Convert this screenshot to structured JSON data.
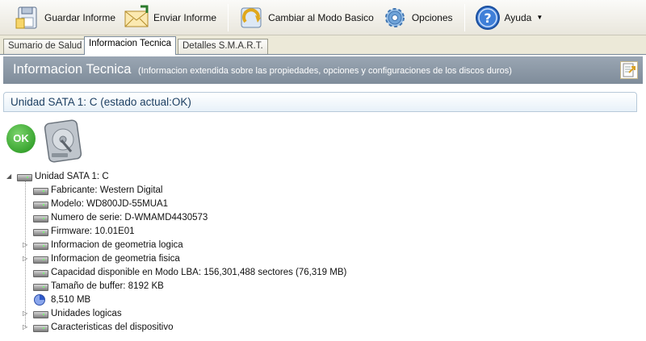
{
  "toolbar": {
    "save_report": "Guardar Informe",
    "send_report": "Enviar Informe",
    "basic_mode": "Cambiar al Modo Basico",
    "options": "Opciones",
    "help": "Ayuda"
  },
  "tabs": [
    {
      "label": "Sumario de Salud"
    },
    {
      "label": "Informacion Tecnica"
    },
    {
      "label": "Detalles S.M.A.R.T."
    }
  ],
  "header": {
    "title": "Informacion Tecnica",
    "subtitle": "(Informacion extendida sobre las propiedades, opciones y configuraciones de los discos duros)"
  },
  "section": {
    "title": "Unidad SATA 1: C (estado actual:OK)",
    "status_badge": "OK"
  },
  "tree": {
    "root": "Unidad SATA 1: C",
    "items": [
      {
        "label": "Fabricante: Western Digital",
        "icon": "drive-icon",
        "expandable": false
      },
      {
        "label": "Modelo: WD800JD-55MUA1",
        "icon": "drive-icon",
        "expandable": false
      },
      {
        "label": "Numero de serie: D-WMAMD4430573",
        "icon": "drive-icon",
        "expandable": false
      },
      {
        "label": "Firmware: 10.01E01",
        "icon": "drive-icon",
        "expandable": false
      },
      {
        "label": "Informacion de geometria logica",
        "icon": "drive-icon",
        "expandable": true
      },
      {
        "label": "Informacion de geometria fisica",
        "icon": "drive-icon",
        "expandable": true
      },
      {
        "label": "Capacidad disponible en Modo LBA: 156,301,488 sectores (76,319 MB)",
        "icon": "drive-icon",
        "expandable": false
      },
      {
        "label": "Tamaño de buffer: 8192 KB",
        "icon": "drive-icon",
        "expandable": false
      },
      {
        "label": "8,510 MB",
        "icon": "pie-chart-icon",
        "expandable": false
      },
      {
        "label": "Unidades logicas",
        "icon": "drive-icon",
        "expandable": true
      },
      {
        "label": "Caracteristicas del dispositivo",
        "icon": "drive-icon",
        "expandable": true
      }
    ]
  }
}
